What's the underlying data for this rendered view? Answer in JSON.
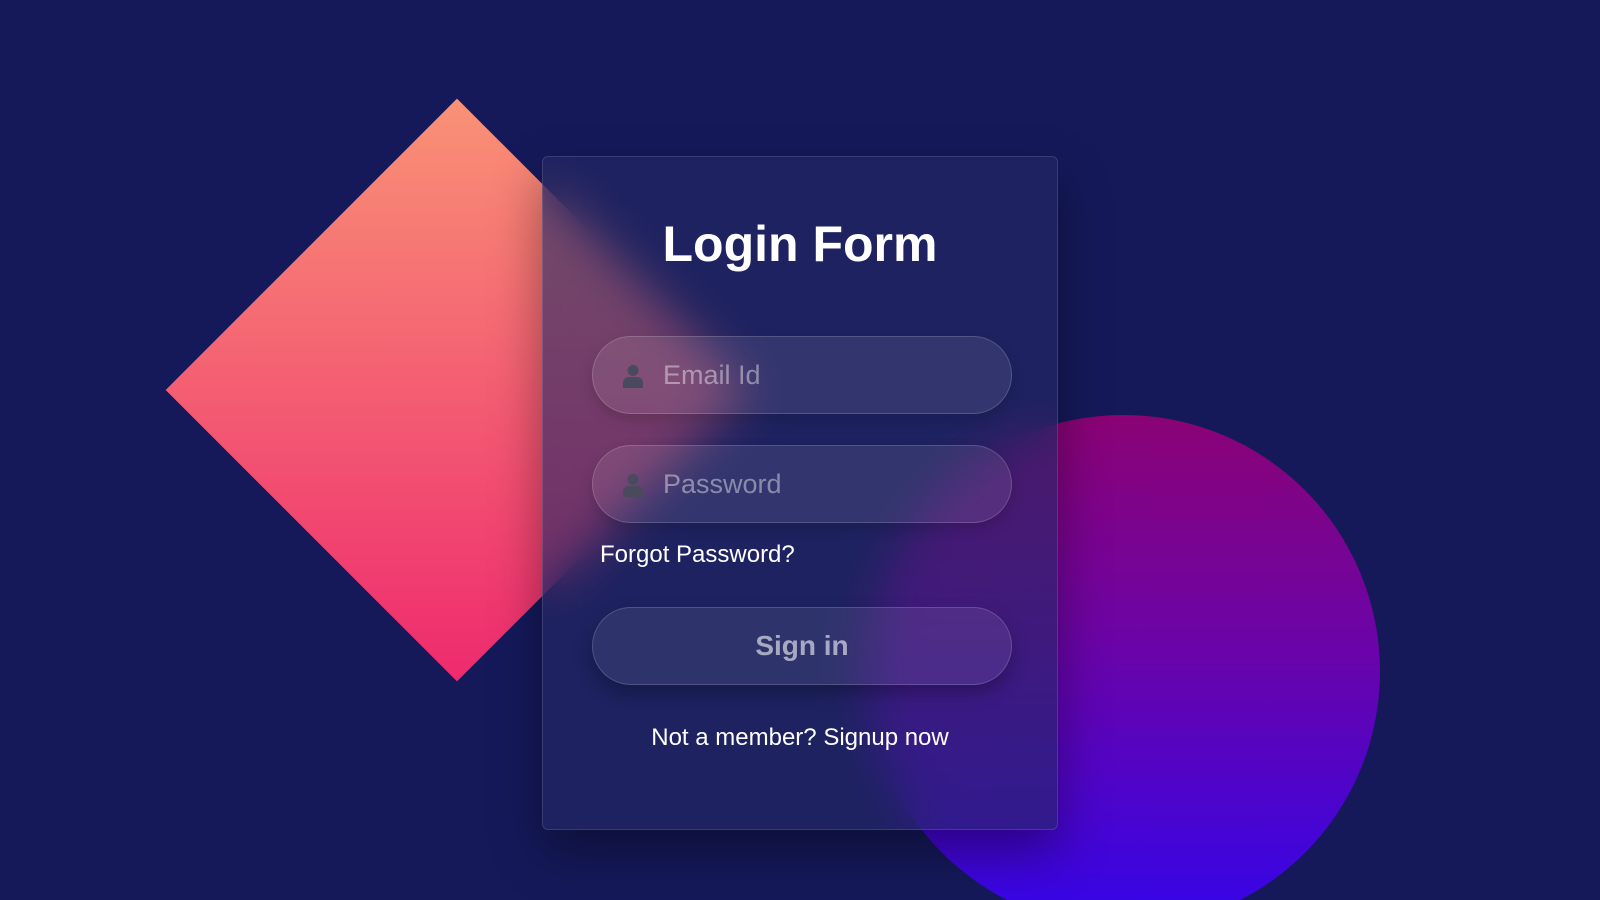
{
  "colors": {
    "background": "#15195a",
    "diamond_top": "#f99276",
    "diamond_bottom": "#ee2a6e",
    "circle_top": "#8b0375",
    "circle_bottom": "#3305ea",
    "text": "#ffffff"
  },
  "form": {
    "title": "Login Form",
    "email": {
      "placeholder": "Email Id",
      "value": "",
      "icon": "user-icon"
    },
    "password": {
      "placeholder": "Password",
      "value": "",
      "icon": "user-icon"
    },
    "forgot_label": "Forgot Password?",
    "signin_label": "Sign in",
    "signup_prompt": "Not a member?",
    "signup_link": "Signup now"
  }
}
